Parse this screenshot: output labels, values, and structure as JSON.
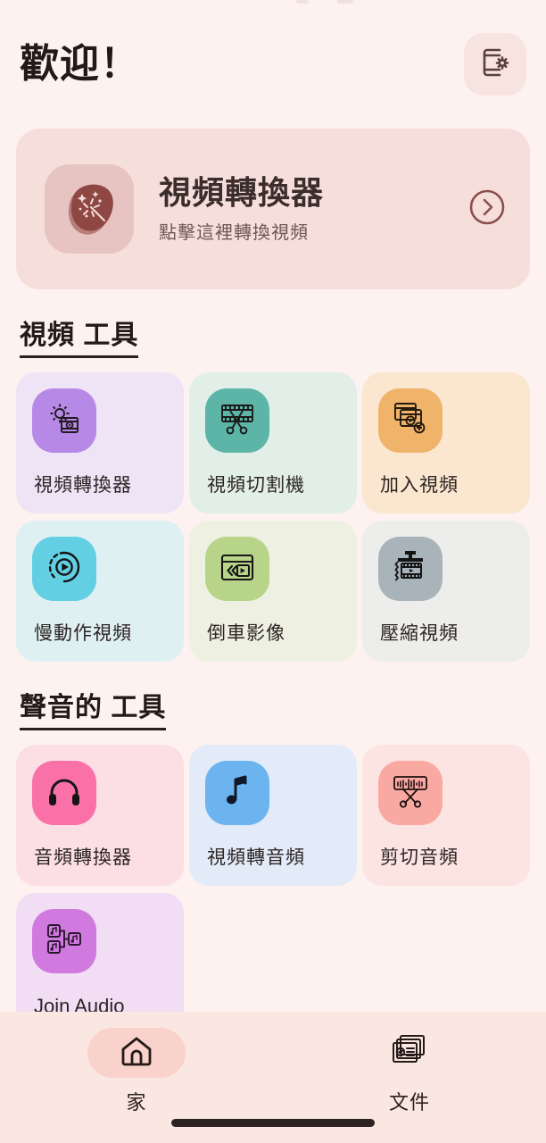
{
  "app": {
    "background_color": "#fdf2ef",
    "accent_color": "#8b4f4c"
  },
  "header": {
    "welcome_title": "歡迎！",
    "settings_button": {
      "name": "device-settings-button",
      "icon": "phone-gear-icon"
    }
  },
  "banner": {
    "title": "視頻轉換器",
    "subtitle": "點擊這裡轉換視頻",
    "icon": "magic-wand-blob-icon",
    "arrow_icon": "chevron-right-circle-icon",
    "background_color": "#f6dedb",
    "icon_bg_color": "#e7c4c1",
    "blob_color": "#8f4744"
  },
  "sections": [
    {
      "id": "video-tools",
      "heading": "視頻 工具",
      "tiles": [
        {
          "label": "視頻轉換器",
          "icon": "gear-film-icon",
          "tile_bg": "#efe3f6",
          "icon_bg": "#b689e6",
          "latin": false
        },
        {
          "label": "視頻切割機",
          "icon": "film-scissors-icon",
          "tile_bg": "#e2efe9",
          "icon_bg": "#5cb5a6",
          "latin": false
        },
        {
          "label": "加入視頻",
          "icon": "add-video-icon",
          "tile_bg": "#fbe6d0",
          "icon_bg": "#f0b36a",
          "latin": false
        },
        {
          "label": "慢動作視頻",
          "icon": "slow-motion-play-icon",
          "tile_bg": "#dff0f2",
          "icon_bg": "#62cfe3",
          "latin": false
        },
        {
          "label": "倒車影像",
          "icon": "reverse-video-icon",
          "tile_bg": "#eef1e2",
          "icon_bg": "#b8d489",
          "latin": false
        },
        {
          "label": "壓縮視頻",
          "icon": "compress-video-icon",
          "tile_bg": "#ededec",
          "icon_bg": "#a9b3ba",
          "latin": false
        }
      ]
    },
    {
      "id": "audio-tools",
      "heading": "聲音的 工具",
      "tiles": [
        {
          "label": "音頻轉換器",
          "icon": "headphones-icon",
          "tile_bg": "#fbdfe4",
          "icon_bg": "#fa71a8",
          "latin": false
        },
        {
          "label": "視頻轉音頻",
          "icon": "music-note-icon",
          "tile_bg": "#e2ebf7",
          "icon_bg": "#6cb4f0",
          "latin": false
        },
        {
          "label": "剪切音頻",
          "icon": "waveform-scissors-icon",
          "tile_bg": "#fbe4e2",
          "icon_bg": "#faa9a2",
          "latin": false
        },
        {
          "label": "Join Audio",
          "icon": "join-audio-icon",
          "tile_bg": "#f1ddf4",
          "icon_bg": "#d07ae0",
          "latin": true
        }
      ]
    }
  ],
  "bottom_nav": {
    "background_color": "#fbe7e2",
    "items": [
      {
        "label": "家",
        "icon": "home-icon",
        "active": true
      },
      {
        "label": "文件",
        "icon": "files-icon",
        "active": false
      }
    ]
  }
}
